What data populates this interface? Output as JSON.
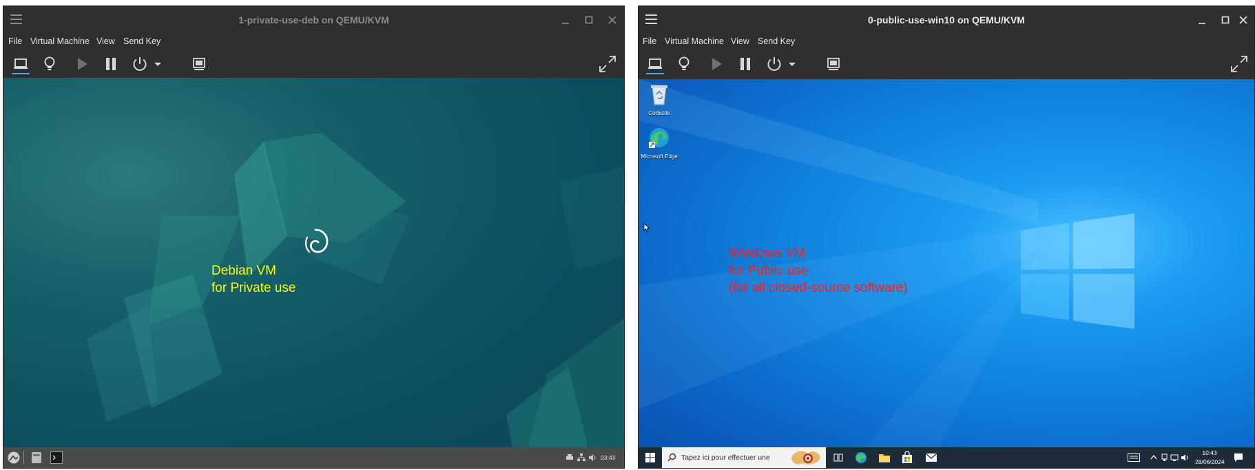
{
  "left_window": {
    "title": "1-private-use-deb on QEMU/KVM",
    "menu": [
      "File",
      "Virtual Machine",
      "View",
      "Send Key"
    ],
    "overlay_text": "Debian VM\nfor Private use",
    "overlay_color": "#ffff00",
    "taskbar_clock": "03:43"
  },
  "right_window": {
    "title": "0-public-use-win10 on QEMU/KVM",
    "menu": [
      "File",
      "Virtual Machine",
      "View",
      "Send Key"
    ],
    "overlay_text": "Windows VM\nfor Public use\n(for all closed-source software)",
    "overlay_color": "#ff1a1a",
    "desktop_icons": [
      "Corbeille",
      "Microsoft Edge"
    ],
    "search_placeholder": "Tapez ici pour effectuer une",
    "clock_time": "10:43",
    "clock_date": "28/06/2024"
  },
  "icons": {
    "toolbar": [
      "display-icon",
      "bulb-icon",
      "play-icon",
      "pause-icon",
      "power-icon",
      "dropdown-icon",
      "screenshot-icon",
      "fullscreen-icon"
    ],
    "window_controls": [
      "minimize-icon",
      "maximize-icon",
      "close-icon"
    ]
  }
}
